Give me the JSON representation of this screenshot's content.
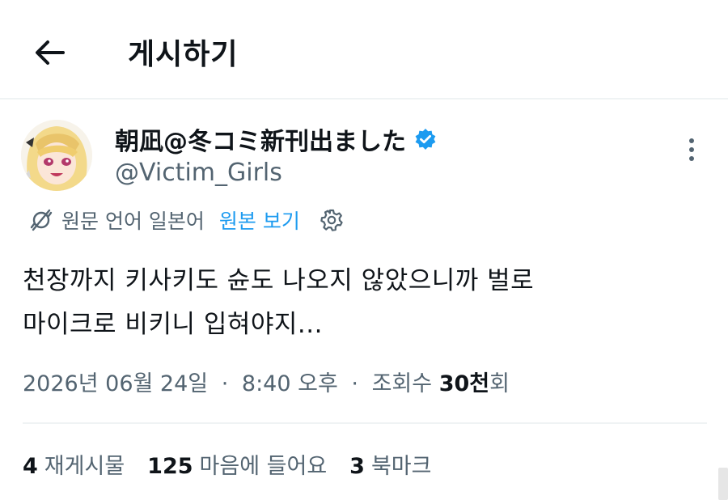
{
  "header": {
    "title": "게시하기",
    "back_icon": "arrow-left-icon"
  },
  "post": {
    "author": {
      "display_name": "朝凪@冬コミ新刊出ました",
      "handle": "@Victim_Girls",
      "verified": true,
      "verified_color": "#1d9bf0"
    },
    "translation": {
      "label": "원문 언어 일본어",
      "link": "원본 보기"
    },
    "text_line1": "천장까지 키사키도 슌도 나오지 않았으니까 벌로",
    "text_line2": "마이크로 비키니 입혀야지...",
    "meta": {
      "date": "2026년 06월 24일",
      "separator": "·",
      "time": "8:40 오후",
      "views_label": "조회수",
      "views_num": "30천",
      "views_suffix": "회"
    },
    "stats": [
      {
        "num": "4",
        "label": "재게시물"
      },
      {
        "num": "125",
        "label": "마음에 들어요"
      },
      {
        "num": "3",
        "label": "북마크"
      }
    ]
  },
  "colors": {
    "accent": "#1d9bf0",
    "text": "#0f1419",
    "secondary": "#536471"
  }
}
